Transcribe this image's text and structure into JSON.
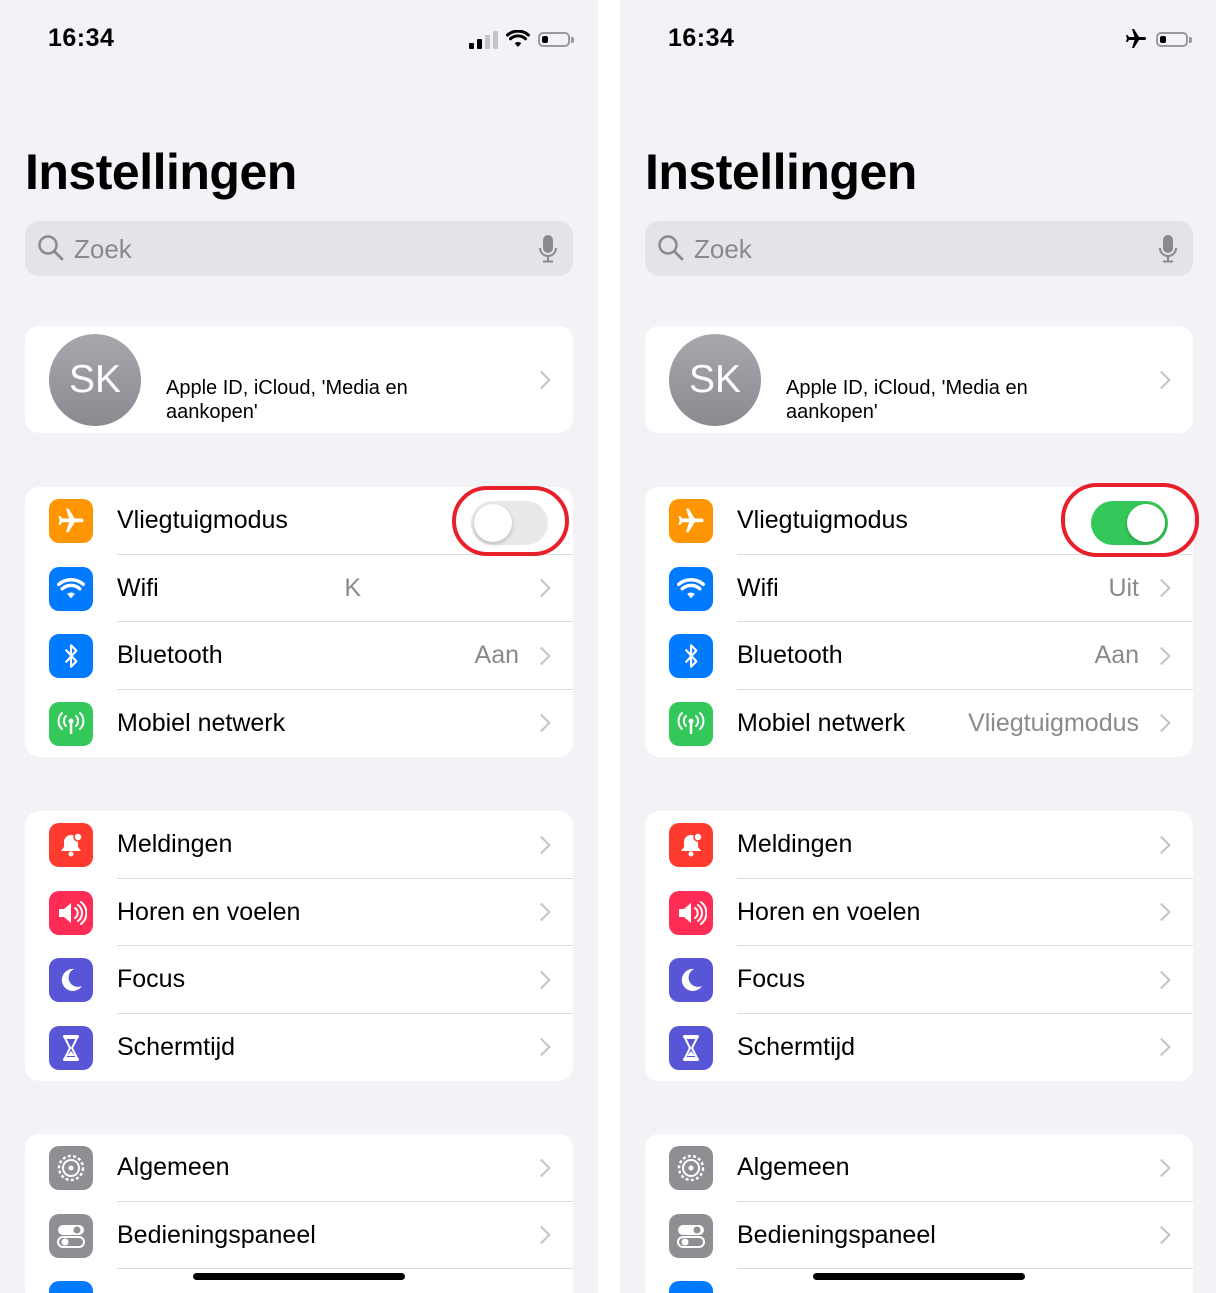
{
  "screens": [
    {
      "status": {
        "time": "16:34",
        "icons": [
          "signal-icon",
          "wifi-icon",
          "battery-icon"
        ]
      },
      "title": "Instellingen",
      "search": {
        "placeholder": "Zoek"
      },
      "profile": {
        "initials": "SK",
        "subtitle": "Apple ID, iCloud, 'Media en aankopen'"
      },
      "connectivity": [
        {
          "label": "Vliegtuigmodus",
          "icon": "airplane-icon",
          "color": "#ff9500",
          "toggle": false
        },
        {
          "label": "Wifi",
          "icon": "wifi-icon",
          "color": "#007aff",
          "value": "K"
        },
        {
          "label": "Bluetooth",
          "icon": "bluetooth-icon",
          "color": "#007aff",
          "value": "Aan"
        },
        {
          "label": "Mobiel netwerk",
          "icon": "antenna-icon",
          "color": "#34c759",
          "value": ""
        }
      ],
      "notifications": [
        {
          "label": "Meldingen",
          "icon": "bell-icon",
          "color": "#ff3b30"
        },
        {
          "label": "Horen en voelen",
          "icon": "speaker-icon",
          "color": "#ff2d55"
        },
        {
          "label": "Focus",
          "icon": "moon-icon",
          "color": "#5856d6"
        },
        {
          "label": "Schermtijd",
          "icon": "hourglass-icon",
          "color": "#5856d6"
        }
      ],
      "general": [
        {
          "label": "Algemeen",
          "icon": "gear-icon",
          "color": "#8e8e93"
        },
        {
          "label": "Bedieningspaneel",
          "icon": "switches-icon",
          "color": "#8e8e93"
        }
      ]
    },
    {
      "status": {
        "time": "16:34",
        "icons": [
          "airplane-icon",
          "battery-icon"
        ]
      },
      "title": "Instellingen",
      "search": {
        "placeholder": "Zoek"
      },
      "profile": {
        "initials": "SK",
        "subtitle": "Apple ID, iCloud, 'Media en aankopen'"
      },
      "connectivity": [
        {
          "label": "Vliegtuigmodus",
          "icon": "airplane-icon",
          "color": "#ff9500",
          "toggle": true
        },
        {
          "label": "Wifi",
          "icon": "wifi-icon",
          "color": "#007aff",
          "value": "Uit"
        },
        {
          "label": "Bluetooth",
          "icon": "bluetooth-icon",
          "color": "#007aff",
          "value": "Aan"
        },
        {
          "label": "Mobiel netwerk",
          "icon": "antenna-icon",
          "color": "#34c759",
          "value": "Vliegtuigmodus"
        }
      ],
      "notifications": [
        {
          "label": "Meldingen",
          "icon": "bell-icon",
          "color": "#ff3b30"
        },
        {
          "label": "Horen en voelen",
          "icon": "speaker-icon",
          "color": "#ff2d55"
        },
        {
          "label": "Focus",
          "icon": "moon-icon",
          "color": "#5856d6"
        },
        {
          "label": "Schermtijd",
          "icon": "hourglass-icon",
          "color": "#5856d6"
        }
      ],
      "general": [
        {
          "label": "Algemeen",
          "icon": "gear-icon",
          "color": "#8e8e93"
        },
        {
          "label": "Bedieningspaneel",
          "icon": "switches-icon",
          "color": "#8e8e93"
        }
      ]
    }
  ],
  "highlight_color": "#e8202a"
}
